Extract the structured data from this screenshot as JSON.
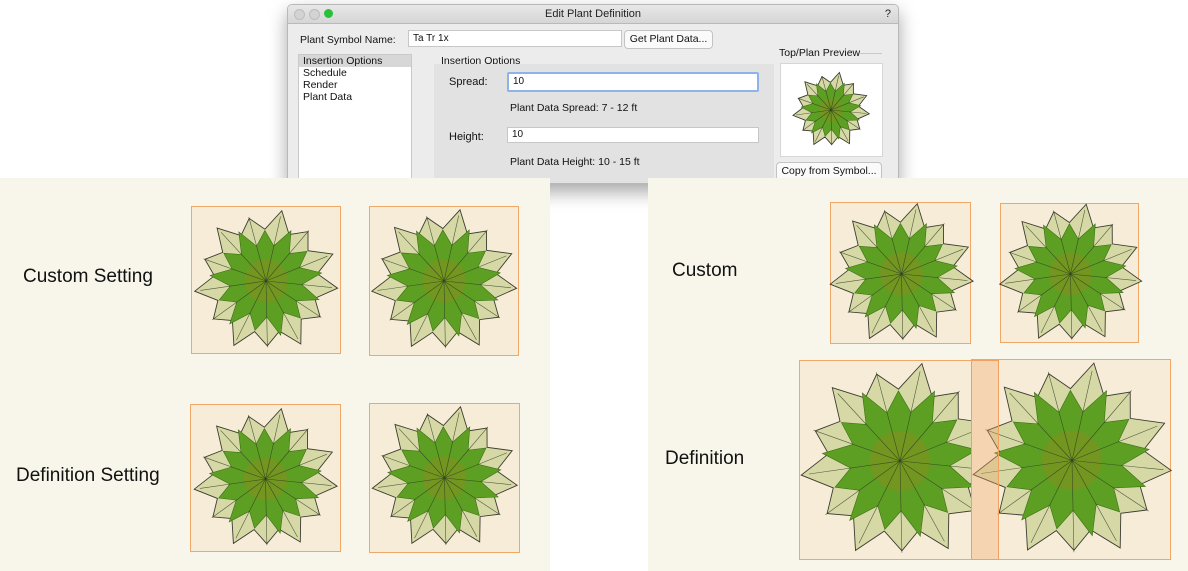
{
  "dialog": {
    "title": "Edit Plant Definition",
    "help": "?",
    "symbol_label": "Plant Symbol Name:",
    "symbol_value": "Ta Tr 1x",
    "get_data_button": "Get Plant Data...",
    "categories": [
      "Insertion Options",
      "Schedule",
      "Render",
      "Plant Data"
    ],
    "selected_category": "Insertion Options",
    "options_heading": "Insertion Options",
    "spread_label": "Spread:",
    "spread_value": "10",
    "spread_range": "Plant Data Spread: 7 - 12 ft",
    "height_label": "Height:",
    "height_value": "10",
    "height_range": "Plant Data Height: 10 - 15 ft",
    "preview_heading": "Top/Plan Preview",
    "copy_button": "Copy from Symbol..."
  },
  "canvas_left": {
    "row_labels": [
      "Custom Setting",
      "Definition Setting"
    ]
  },
  "canvas_right": {
    "row_labels": [
      "Custom",
      "Definition"
    ]
  },
  "colors": {
    "canvas_bg": "#f8f6ea",
    "box_fill": "#f7ecd8",
    "box_border": "#f0a868",
    "leaf_outer": "#d6d8a6",
    "leaf_inner": "#5d9f23",
    "leaf_center": "#7c9320",
    "traffic_zoom": "#29c13b",
    "focus_ring": "#8cb4ea"
  }
}
